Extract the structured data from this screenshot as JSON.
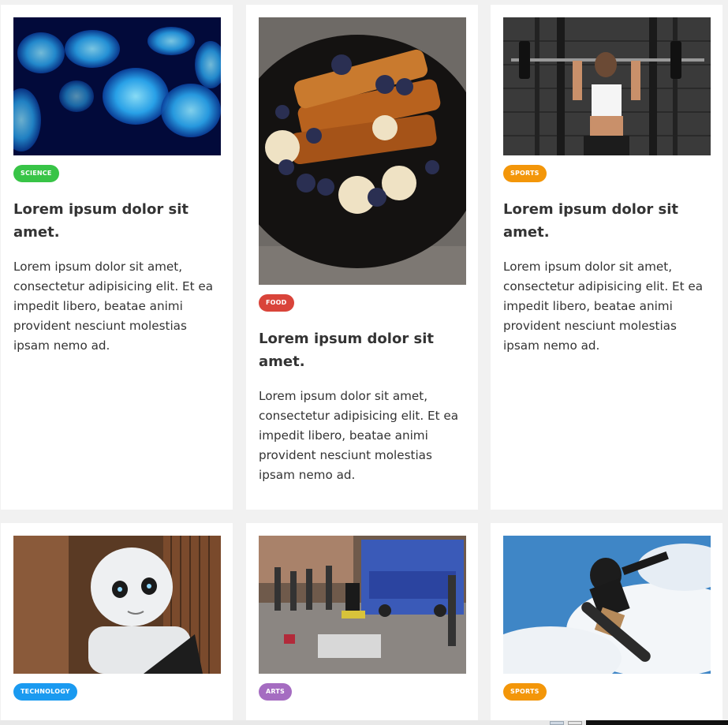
{
  "cards": [
    {
      "category": "SCIENCE",
      "category_color": "#38c447",
      "image_subject": "jellyfish-image",
      "title": "Lorem ipsum dolor sit amet.",
      "description": "Lorem ipsum dolor sit amet, consectetur adipisicing elit. Et ea impedit libero, beatae animi provident nesciunt molestias ipsam nemo ad."
    },
    {
      "category": "FOOD",
      "category_color": "#d9443a",
      "image_subject": "french-toast-image",
      "title": "Lorem ipsum dolor sit amet.",
      "description": "Lorem ipsum dolor sit amet, consectetur adipisicing elit. Et ea impedit libero, beatae animi provident nesciunt molestias ipsam nemo ad."
    },
    {
      "category": "SPORTS",
      "category_color": "#f39609",
      "image_subject": "weightlifting-image",
      "title": "Lorem ipsum dolor sit amet.",
      "description": "Lorem ipsum dolor sit amet, consectetur adipisicing elit. Et ea impedit libero, beatae animi provident nesciunt molestias ipsam nemo ad."
    },
    {
      "category": "TECHNOLOGY",
      "category_color": "#1a9af0",
      "image_subject": "robot-image"
    },
    {
      "category": "ARTS",
      "category_color": "#a56cc1",
      "image_subject": "breakdancer-image"
    },
    {
      "category": "SPORTS",
      "category_color": "#f39609",
      "image_subject": "snowboarder-image"
    }
  ]
}
